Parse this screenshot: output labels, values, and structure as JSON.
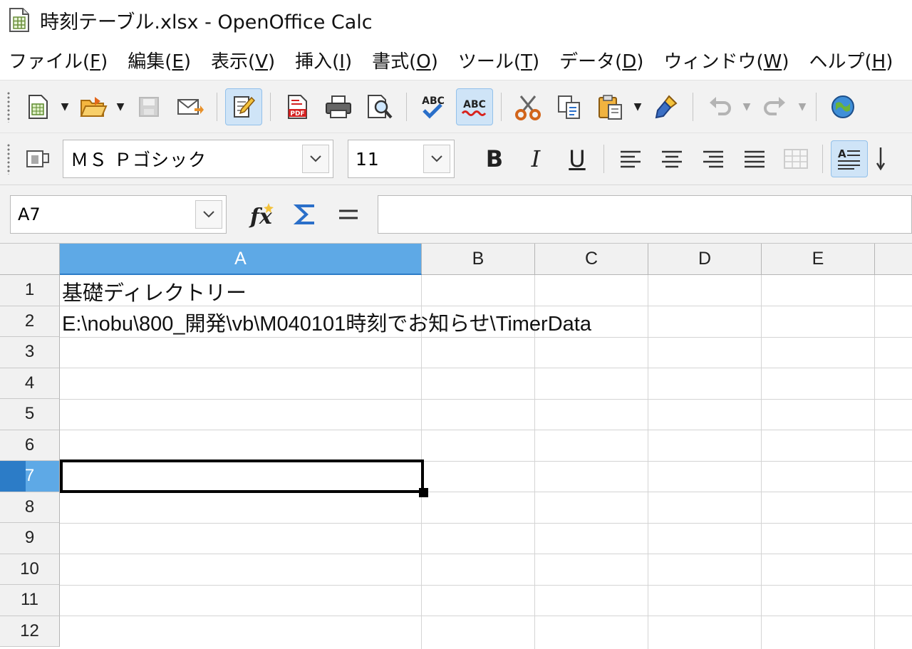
{
  "window": {
    "title": "時刻テーブル.xlsx - OpenOffice Calc",
    "app_icon": "calc-spreadsheet-icon"
  },
  "menubar": {
    "items": [
      {
        "label": "ファイル(",
        "key": "F",
        "end": ")"
      },
      {
        "label": "編集(",
        "key": "E",
        "end": ")"
      },
      {
        "label": "表示(",
        "key": "V",
        "end": ")"
      },
      {
        "label": "挿入(",
        "key": "I",
        "end": ")"
      },
      {
        "label": "書式(",
        "key": "O",
        "end": ")"
      },
      {
        "label": "ツール(",
        "key": "T",
        "end": ")"
      },
      {
        "label": "データ(",
        "key": "D",
        "end": ")"
      },
      {
        "label": "ウィンドウ(",
        "key": "W",
        "end": ")"
      },
      {
        "label": "ヘルプ(",
        "key": "H",
        "end": ")"
      }
    ]
  },
  "standard_toolbar": {
    "icons": [
      "new-document-icon",
      "open-folder-icon",
      "save-icon",
      "email-document-icon",
      "edit-file-icon",
      "export-pdf-icon",
      "print-icon",
      "page-preview-icon",
      "spellcheck-icon",
      "autospellcheck-icon",
      "cut-icon",
      "copy-icon",
      "paste-icon",
      "clone-formatting-icon",
      "undo-icon",
      "redo-icon",
      "navigator-globe-icon"
    ]
  },
  "formatting_toolbar": {
    "font_name": "ＭＳ Ｐゴシック",
    "font_size": "11",
    "bold_label": "B",
    "italic_label": "I",
    "underline_label": "U"
  },
  "formula_bar": {
    "name_box": "A7",
    "formula_content": ""
  },
  "sheet": {
    "columns": [
      "A",
      "B",
      "C",
      "D",
      "E"
    ],
    "rows": [
      "1",
      "2",
      "3",
      "4",
      "5",
      "6",
      "7",
      "8",
      "9",
      "10",
      "11",
      "12"
    ],
    "selected_column": "A",
    "selected_row": "7",
    "cells": {
      "A1": "基礎ディレクトリー",
      "A2": "E:\\nobu\\800_開発\\vb\\M040101時刻でお知らせ\\TimerData"
    }
  },
  "colors": {
    "selection_header": "#5ea9e6",
    "selection_accent": "#2c7cc7",
    "toolbar_bg": "#f2f2f2",
    "active_toggle": "#cfe4f7"
  }
}
